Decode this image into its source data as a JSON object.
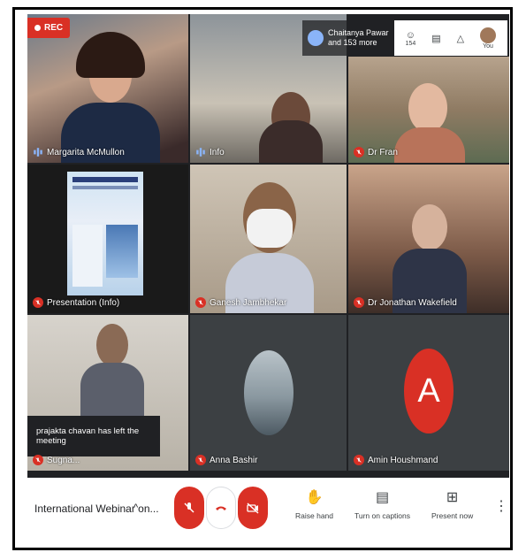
{
  "recording": {
    "label": "REC"
  },
  "participants_pill": {
    "line1": "Chaitanya Pawar",
    "line2": "and 153 more"
  },
  "top_icons": {
    "people_count": "154",
    "you_label": "You"
  },
  "tiles": [
    {
      "name": "Margarita McMullon"
    },
    {
      "name": "Info"
    },
    {
      "name": "Dr Fran"
    },
    {
      "name": "Presentation (Info)"
    },
    {
      "name": "Ganesh Jambhekar"
    },
    {
      "name": "Dr Jonathan Wakefield"
    },
    {
      "name": "Sugna..."
    },
    {
      "name": "Anna Bashir"
    },
    {
      "name": "Amin Houshmand"
    }
  ],
  "amin_avatar_letter": "A",
  "toast": {
    "text": "prajakta chavan has left the meeting"
  },
  "bottom_bar": {
    "meeting_name": "International Webinar on...",
    "raise_hand": "Raise hand",
    "captions": "Turn on captions",
    "present": "Present now"
  },
  "colors": {
    "accent_red": "#d93025",
    "meet_bg": "#202124",
    "avatar_orange": "#d93025"
  }
}
